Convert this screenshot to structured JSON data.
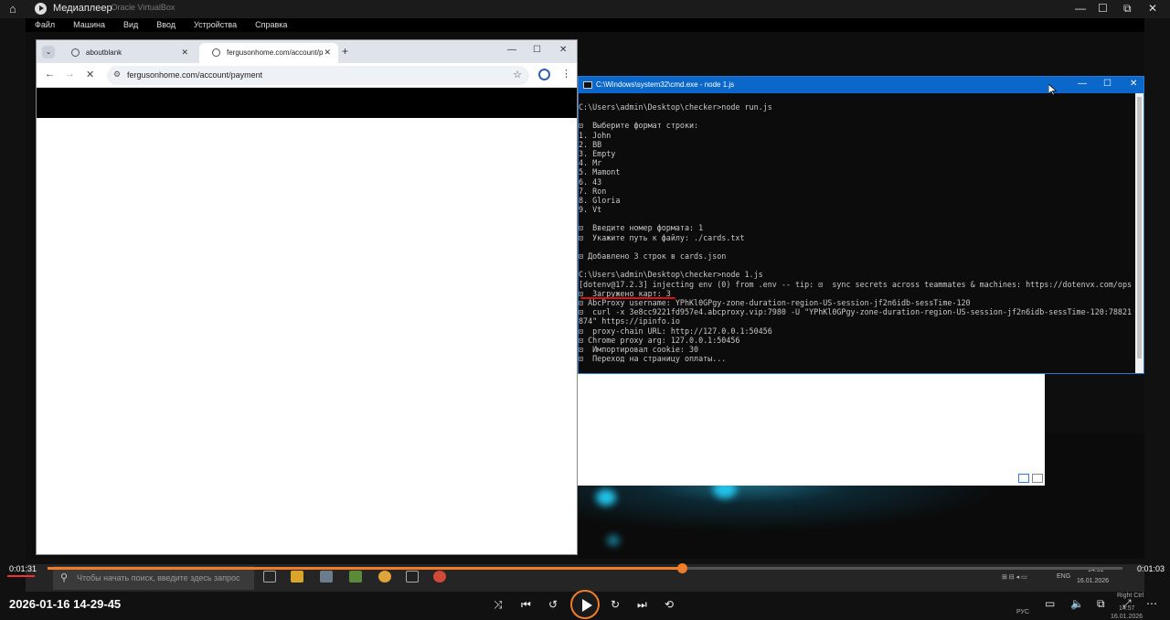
{
  "media_player": {
    "app_title": "Медиаплеер",
    "window_subtitle": "- Oracle VirtualBox",
    "current_time": "0:01:31",
    "total_time": "0:01:03",
    "progress": 0.59,
    "recording_timestamp": "2026-01-16 14-29-45",
    "accent_color": "#f07d2a"
  },
  "virtualbox": {
    "menu": [
      "Файл",
      "Машина",
      "Вид",
      "Ввод",
      "Устройства",
      "Справка"
    ]
  },
  "chrome": {
    "tabs": [
      {
        "title": "aboutblank",
        "active": false
      },
      {
        "title": "fergusonhome.com/account/p",
        "active": true
      }
    ],
    "address": "fergusonhome.com/account/payment"
  },
  "cmd": {
    "title": "C:\\Windows\\system32\\cmd.exe - node  1.js",
    "lines": [
      "C:\\Users\\admin\\Desktop\\checker>node run.js",
      "",
      "⊡  Выберите формат строки:",
      "1. John",
      "2. BB",
      "3. Empty",
      "4. Mr",
      "5. Mamont",
      "6. 43",
      "7. Ron",
      "8. Gloria",
      "9. Vt",
      "",
      "⊡  Введите номер формата: 1",
      "⊡  Укажите путь к файлу: ./cards.txt",
      "",
      "⊡ Добавлено 3 строк в cards.json",
      "",
      "C:\\Users\\admin\\Desktop\\checker>node 1.js",
      "[dotenv@17.2.3] injecting env (0) from .env -- tip: ⊡  sync secrets across teammates & machines: https://dotenvx.com/ops",
      "⊡  Загружено карт: 3",
      "⊡ AbcProxy username: YPhKl0GPgy-zone-duration-region-US-session-jf2n6idb-sessTime-120",
      "⊡  curl -x 3e8cc9221fd957e4.abcproxy.vip:7980 -U \"YPhKl0GPgy-zone-duration-region-US-session-jf2n6idb-sessTime-120:78821",
      "874\" https://ipinfo.io",
      "⊡  proxy-chain URL: http://127.0.0.1:50456",
      "⊡ Chrome proxy arg: 127.0.0.1:50456",
      "⊡  Импортировал cookie: 30",
      "⊡  Переход на страницу оплаты..."
    ]
  },
  "guest_taskbar": {
    "search_placeholder": "Чтобы начать поиск, введите здесь запрос",
    "language": "ENG",
    "clock_time": "14:31",
    "clock_date": "16.01.2026"
  },
  "host_tray": {
    "language": "РУС",
    "clock_time": "14:57",
    "clock_date": "16.01.2026",
    "host_key": "Right Ctrl"
  }
}
